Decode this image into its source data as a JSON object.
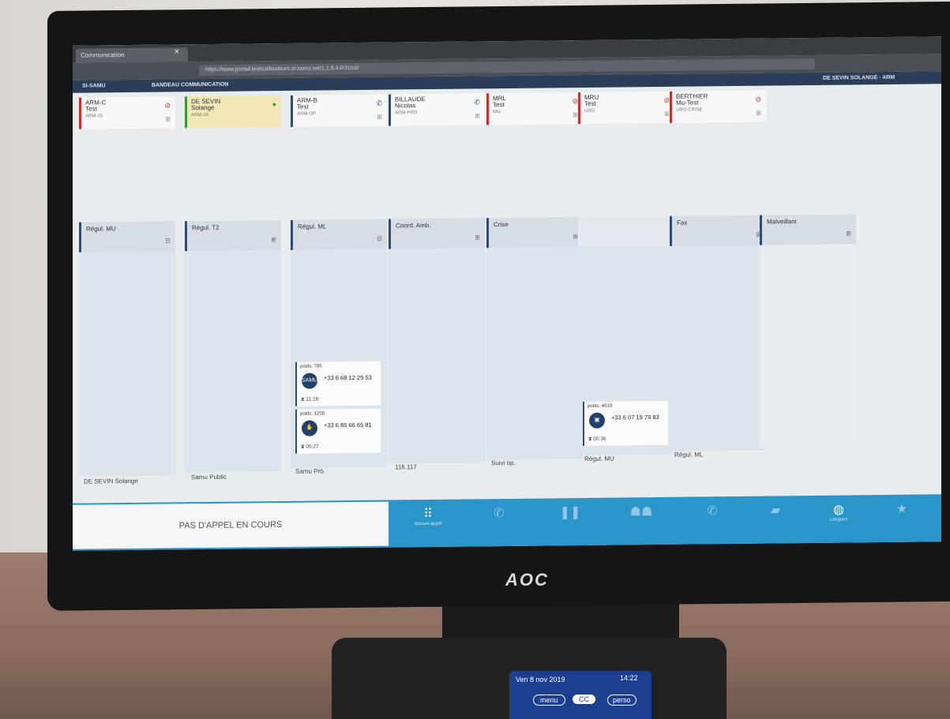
{
  "browser": {
    "tab_title": "Communication",
    "url": "https://www.portail.testsutilisateurs.si-samu.net/1.1.8.3-R31/cti/"
  },
  "app": {
    "brand": "SI-SAMU",
    "section": "BANDEAU COMMUNICATION",
    "user": "DE SEVIN SOLANGE · ARM"
  },
  "agents": [
    {
      "name": "ARM-C",
      "sub": "Test",
      "role": "ARM-15",
      "status": "busy"
    },
    {
      "name": "DE SEVIN",
      "sub": "Solange",
      "role": "ARM-15",
      "status": "available"
    },
    {
      "name": "ARM-B",
      "sub": "Test",
      "role": "ARM-OP",
      "status": "phone"
    },
    {
      "name": "BILLAUDE",
      "sub": "Nicolas",
      "role": "ARM-PRO",
      "status": "phone"
    },
    {
      "name": "MRL",
      "sub": "Test",
      "role": "MG",
      "status": "busy"
    },
    {
      "name": "MRU",
      "sub": "Test",
      "role": "URG",
      "status": "busy"
    },
    {
      "name": "BERTHIER",
      "sub": "Mu-Test",
      "role": "URG-CRISE",
      "status": "busy"
    }
  ],
  "columns": [
    {
      "label": "Régul. MU",
      "footer": "DE SEVIN Solange"
    },
    {
      "label": "Régul. T2",
      "footer": "Samu Public"
    },
    {
      "label": "Régul. ML",
      "footer": "Samu Pro."
    },
    {
      "label": "Coord. Amb.",
      "footer": "116.117"
    },
    {
      "label": "Crise",
      "footer": "Suivi op."
    },
    {
      "label": "",
      "footer": "Régul. MU"
    },
    {
      "label": "Fax",
      "footer": "Régul. ML"
    },
    {
      "label": "Malveillant",
      "footer": ""
    }
  ],
  "calls": [
    {
      "weight": "poids: 785",
      "phone": "+33 6 68 12 29 53",
      "time": "11:18",
      "avatar": "SAMU"
    },
    {
      "weight": "poids: 1200",
      "phone": "+33 6 85 66 65 81",
      "time": "05:27",
      "avatar": ""
    },
    {
      "weight": "poids: 4010",
      "phone": "+33 6 07 19 79 83",
      "time": "05:36",
      "avatar": ""
    }
  ],
  "bottom": {
    "no_call": "PAS D'APPEL EN COURS",
    "new_call": "Nouvel appel",
    "language": "Langues"
  },
  "monitor": {
    "brand": "AOC"
  },
  "phone": {
    "date": "Ven 8 nov 2019",
    "time": "14:22",
    "btn1": "menu",
    "btn2": "CC",
    "btn3": "perso"
  },
  "colors": {
    "accent": "#2a95c9",
    "header": "#2c3e57",
    "busy": "#c9302c",
    "available": "#3c9a3c"
  }
}
